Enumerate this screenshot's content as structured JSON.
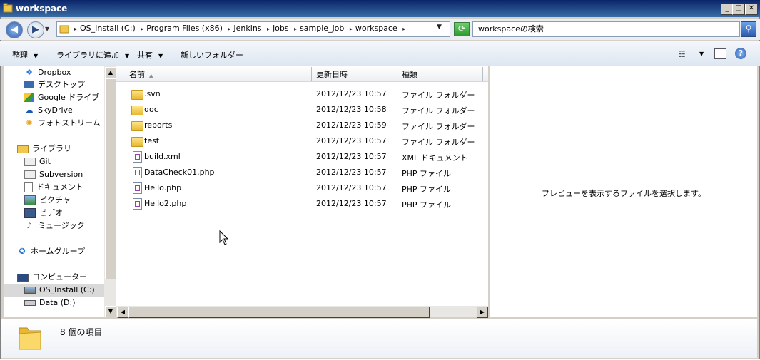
{
  "window": {
    "title": "workspace"
  },
  "address": {
    "crumbs": [
      "OS_Install (C:)",
      "Program Files (x86)",
      "Jenkins",
      "jobs",
      "sample_job",
      "workspace"
    ]
  },
  "search": {
    "placeholder": "workspaceの検索"
  },
  "toolbar": {
    "organize": "整理",
    "add_to_library": "ライブラリに追加",
    "share": "共有",
    "new_folder": "新しいフォルダー"
  },
  "nav": {
    "favorites": [
      "Dropbox",
      "デスクトップ",
      "Google ドライブ",
      "SkyDrive",
      "フォトストリーム"
    ],
    "library_title": "ライブラリ",
    "libraries": [
      "Git",
      "Subversion",
      "ドキュメント",
      "ピクチャ",
      "ビデオ",
      "ミュージック"
    ],
    "homegroup": "ホームグループ",
    "computer_title": "コンピューター",
    "drives": [
      "OS_Install (C:)",
      "Data (D:)"
    ]
  },
  "columns": {
    "name": "名前",
    "modified": "更新日時",
    "type": "種類"
  },
  "files": [
    {
      "name": ".svn",
      "date": "2012/12/23 10:57",
      "type": "ファイル フォルダー",
      "kind": "folder"
    },
    {
      "name": "doc",
      "date": "2012/12/23 10:58",
      "type": "ファイル フォルダー",
      "kind": "folder"
    },
    {
      "name": "reports",
      "date": "2012/12/23 10:59",
      "type": "ファイル フォルダー",
      "kind": "folder"
    },
    {
      "name": "test",
      "date": "2012/12/23 10:57",
      "type": "ファイル フォルダー",
      "kind": "folder"
    },
    {
      "name": "build.xml",
      "date": "2012/12/23 10:57",
      "type": "XML ドキュメント",
      "kind": "file"
    },
    {
      "name": "DataCheck01.php",
      "date": "2012/12/23 10:57",
      "type": "PHP ファイル",
      "kind": "file"
    },
    {
      "name": "Hello.php",
      "date": "2012/12/23 10:57",
      "type": "PHP ファイル",
      "kind": "file"
    },
    {
      "name": "Hello2.php",
      "date": "2012/12/23 10:57",
      "type": "PHP ファイル",
      "kind": "file"
    }
  ],
  "preview": {
    "message": "プレビューを表示するファイルを選択します。"
  },
  "status": {
    "item_count": "8 個の項目"
  }
}
